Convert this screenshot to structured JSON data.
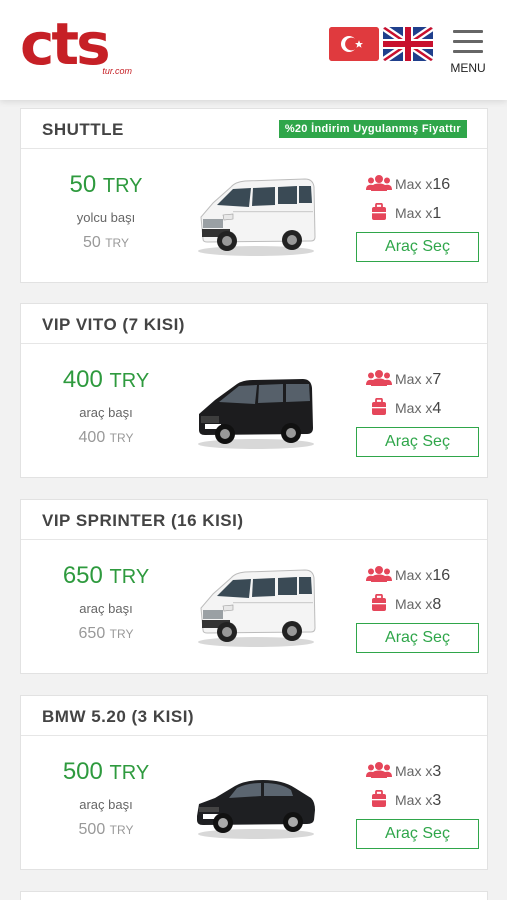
{
  "header": {
    "logo_text": "cts",
    "logo_sub": "tur.com",
    "menu_label": "MENU"
  },
  "colors": {
    "brand_red": "#c62026",
    "accent_green": "#2fa64a",
    "price_green": "#2e9a3e",
    "icon_red": "#e5465a"
  },
  "labels": {
    "max": "Max",
    "times": "x"
  },
  "vehicles": [
    {
      "title": "SHUTTLE",
      "discount": "%20 İndirim Uygulanmış Fiyattır",
      "price": "50",
      "currency": "TRY",
      "per": "yolcu başı",
      "orig_price": "50",
      "orig_currency": "TRY",
      "passengers": "16",
      "luggage": "1",
      "button": "Araç Seç",
      "image": "white-van-icon"
    },
    {
      "title": "VIP VITO (7 KISI)",
      "price": "400",
      "currency": "TRY",
      "per": "araç başı",
      "orig_price": "400",
      "orig_currency": "TRY",
      "passengers": "7",
      "luggage": "4",
      "button": "Araç Seç",
      "image": "black-van-icon"
    },
    {
      "title": "VIP SPRINTER (16 KISI)",
      "price": "650",
      "currency": "TRY",
      "per": "araç başı",
      "orig_price": "650",
      "orig_currency": "TRY",
      "passengers": "16",
      "luggage": "8",
      "button": "Araç Seç",
      "image": "white-van-icon"
    },
    {
      "title": "BMW 5.20 (3 KISI)",
      "price": "500",
      "currency": "TRY",
      "per": "araç başı",
      "orig_price": "500",
      "orig_currency": "TRY",
      "passengers": "3",
      "luggage": "3",
      "button": "Araç Seç",
      "image": "black-sedan-icon"
    }
  ]
}
